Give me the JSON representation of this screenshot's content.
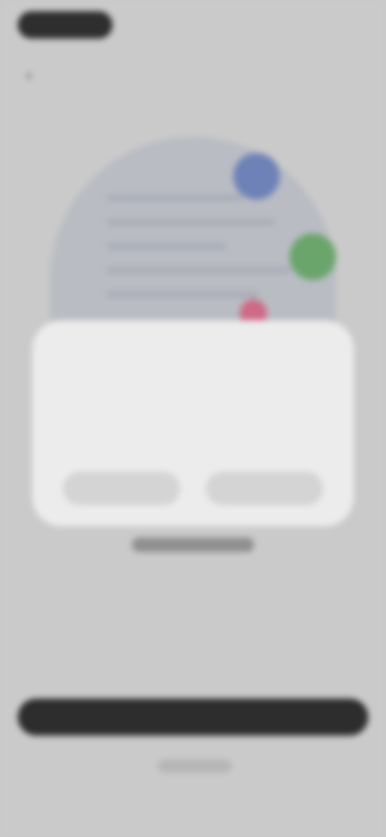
{
  "header": {
    "status_pill_label": "",
    "back_label": "‹"
  },
  "hero": {
    "illustration_name": "location-permission-illustration"
  },
  "sheet": {
    "title": "",
    "body": "",
    "left_button": "",
    "right_button": ""
  },
  "footer": {
    "link_text": "",
    "cta_label": "",
    "subtext": ""
  },
  "colors": {
    "background": "#cacaca",
    "sheet": "#ececec",
    "cta": "#2d2d2d",
    "blue_marker": "#6e82b7",
    "green_marker": "#6aa56b",
    "pink_marker": "#ce6a86"
  }
}
